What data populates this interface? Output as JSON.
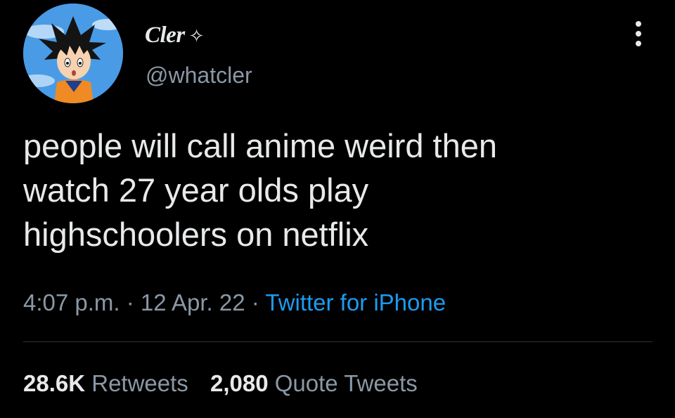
{
  "author": {
    "display_name": "Cler",
    "name_badge": "✧",
    "handle": "@whatcler",
    "avatar_icon": "goku-avatar-icon"
  },
  "more_icon": "more-vertical-icon",
  "tweet": {
    "lines": [
      "people will call anime weird then",
      "watch 27 year olds play",
      "highschoolers on netflix"
    ],
    "time": "4:07 p.m.",
    "separator": "·",
    "date": "12 Apr. 22",
    "source": "Twitter for iPhone"
  },
  "stats": {
    "retweets_value": "28.6K",
    "retweets_label": "Retweets",
    "quotes_value": "2,080",
    "quotes_label": "Quote Tweets"
  },
  "colors": {
    "background": "#000000",
    "text_primary": "#e7e9ea",
    "text_secondary": "#8b98a5",
    "link": "#1d9bf0",
    "divider": "#2f3336"
  }
}
